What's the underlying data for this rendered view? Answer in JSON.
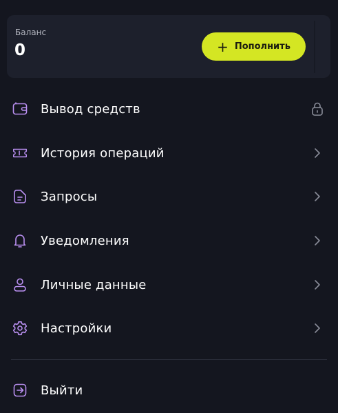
{
  "balance": {
    "label": "Баланс",
    "value": "0",
    "topup_label": "Пополнить"
  },
  "menu": [
    {
      "label": "Вывод средств",
      "icon": "wallet-icon",
      "trailing": "lock-icon"
    },
    {
      "label": "История операций",
      "icon": "ticket-icon",
      "trailing": "chevron-right-icon"
    },
    {
      "label": "Запросы",
      "icon": "document-icon",
      "trailing": "chevron-right-icon"
    },
    {
      "label": "Уведомления",
      "icon": "bell-icon",
      "trailing": "chevron-right-icon"
    },
    {
      "label": "Личные данные",
      "icon": "user-icon",
      "trailing": "chevron-right-icon"
    },
    {
      "label": "Настройки",
      "icon": "gear-icon",
      "trailing": "chevron-right-icon"
    }
  ],
  "logout": {
    "label": "Выйти",
    "icon": "logout-icon"
  },
  "colors": {
    "background": "#14161f",
    "card": "#1d202c",
    "accent": "#d4e623",
    "icon": "#b98ff0",
    "muted": "#8a8d99"
  }
}
